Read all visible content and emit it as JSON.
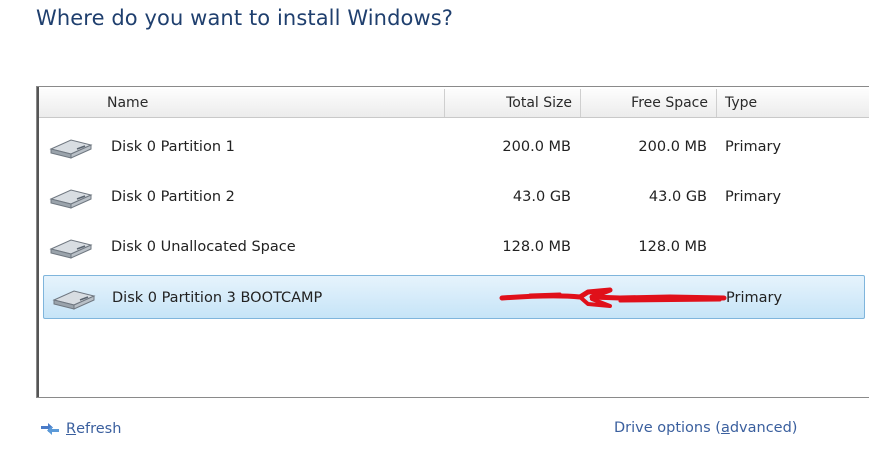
{
  "page": {
    "title": "Where do you want to install Windows?"
  },
  "table": {
    "columns": {
      "name": "Name",
      "total_size": "Total Size",
      "free_space": "Free Space",
      "type": "Type"
    },
    "rows": [
      {
        "name": "Disk 0 Partition 1",
        "total_size": "200.0 MB",
        "free_space": "200.0 MB",
        "type": "Primary",
        "icon": "hard-drive-icon"
      },
      {
        "name": "Disk 0 Partition 2",
        "total_size": "43.0 GB",
        "free_space": "43.0 GB",
        "type": "Primary",
        "icon": "hard-drive-icon"
      },
      {
        "name": "Disk 0 Unallocated Space",
        "total_size": "128.0 MB",
        "free_space": "128.0 MB",
        "type": "",
        "icon": "hard-drive-icon"
      },
      {
        "name": "Disk 0 Partition 3 BOOTCAMP",
        "total_size": "",
        "free_space": "",
        "type": "Primary",
        "icon": "hard-drive-icon",
        "selected": true
      }
    ]
  },
  "annotation": {
    "icon": "red-arrow-annotation",
    "color": "#e0101a"
  },
  "footer": {
    "refresh_label_accel": "R",
    "refresh_label_rest": "efresh",
    "drive_options_pre": "Drive options (",
    "drive_options_accel": "a",
    "drive_options_post": "dvanced)"
  },
  "colors": {
    "title": "#1f3f6e",
    "link": "#3a5f9e",
    "selection": "#c6e4f7"
  }
}
